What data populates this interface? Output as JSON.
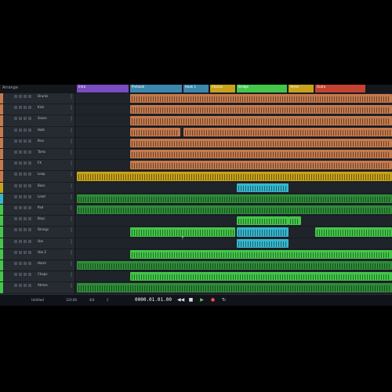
{
  "app": {
    "arrange_label": "Arrange"
  },
  "colors": {
    "orange": "#c57a4d",
    "yellow": "#c8a21a",
    "green": "#43c64a",
    "dark_green": "#2e8c39",
    "cyan": "#36b7cf",
    "purple": "#7b4bc1",
    "blue": "#3c87ad",
    "red": "#c34232"
  },
  "sections": [
    {
      "label": "Intro",
      "color": "#7b4bc1"
    },
    {
      "label": "Prehook",
      "color": "#3c87ad"
    },
    {
      "label": "Hook 1",
      "color": "#3c87ad"
    },
    {
      "label": "Chorus",
      "color": "#c8a21a"
    },
    {
      "label": "Bridge",
      "color": "#43c64a"
    },
    {
      "label": "Verse",
      "color": "#c8a21a"
    },
    {
      "label": "Outro",
      "color": "#c34232"
    }
  ],
  "tracks": [
    {
      "name": "Drums",
      "color": "#c57a4d"
    },
    {
      "name": "Kick",
      "color": "#c57a4d"
    },
    {
      "name": "Snare",
      "color": "#c57a4d"
    },
    {
      "name": "Hats",
      "color": "#c57a4d"
    },
    {
      "name": "Perc",
      "color": "#c57a4d"
    },
    {
      "name": "Toms",
      "color": "#c57a4d"
    },
    {
      "name": "FX",
      "color": "#c57a4d"
    },
    {
      "name": "Loop",
      "color": "#c57a4d"
    },
    {
      "name": "Bass",
      "color": "#c8a21a"
    },
    {
      "name": "Lead",
      "color": "#36b7cf"
    },
    {
      "name": "Pad",
      "color": "#43c64a"
    },
    {
      "name": "Keys",
      "color": "#43c64a"
    },
    {
      "name": "Strings",
      "color": "#43c64a"
    },
    {
      "name": "Vox",
      "color": "#43c64a"
    },
    {
      "name": "Vox 2",
      "color": "#43c64a"
    },
    {
      "name": "Harm",
      "color": "#43c64a"
    },
    {
      "name": "Chops",
      "color": "#43c64a"
    },
    {
      "name": "Atmos",
      "color": "#43c64a"
    }
  ],
  "transport": {
    "timecode": "0000.01.01.00",
    "tempo": "120.00",
    "time_sig": "4/4",
    "key": "C",
    "project": "Untitled"
  }
}
